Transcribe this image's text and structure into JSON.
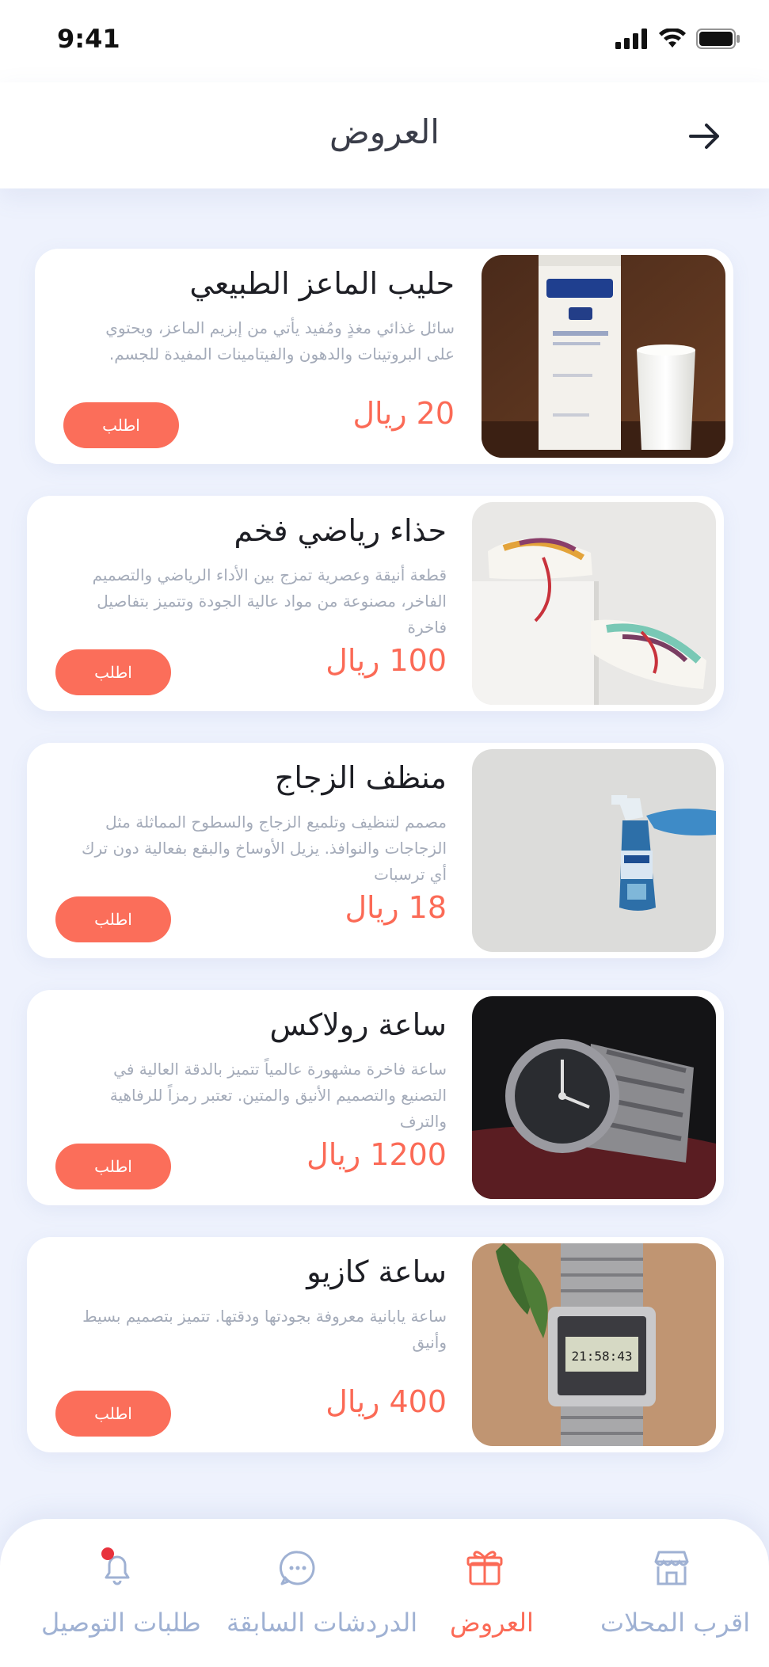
{
  "status_bar": {
    "time": "9:41"
  },
  "header": {
    "title": "العروض"
  },
  "products": [
    {
      "name": "حليب الماعز الطبيعي",
      "description": "سائل غذائي مغذٍ ومُفيد يأتي من إبزيم الماعز، ويحتوي على البروتينات والدهون والفيتامينات المفيدة للجسم.",
      "price": "20 ريال",
      "order_label": "اطلب",
      "image": "goat-milk-carton-and-glass"
    },
    {
      "name": "حذاء رياضي فخم",
      "description": "قطعة أنيقة وعصرية تمزج بين الأداء الرياضي والتصميم الفاخر، مصنوعة من مواد عالية الجودة وتتميز بتفاصيل فاخرة",
      "price": "100 ريال",
      "order_label": "اطلب",
      "image": "sneakers"
    },
    {
      "name": "منظف الزجاج",
      "description": "مصمم لتنظيف وتلميع الزجاج والسطوح المماثلة مثل الزجاجات والنوافذ. يزيل الأوساخ والبقع بفعالية دون ترك أي ترسبات",
      "price": "18 ريال",
      "order_label": "اطلب",
      "image": "glass-cleaner-spray"
    },
    {
      "name": "ساعة رولاكس",
      "description": "ساعة فاخرة مشهورة عالمياً تتميز بالدقة العالية في التصنيع والتصميم الأنيق والمتين. تعتبر رمزاً للرفاهية والترف",
      "price": "1200 ريال",
      "order_label": "اطلب",
      "image": "rolex-watch"
    },
    {
      "name": "ساعة كازيو",
      "description": "ساعة يابانية معروفة بجودتها ودقتها. تتميز بتصميم بسيط وأنيق",
      "price": "400 ريال",
      "order_label": "اطلب",
      "image": "casio-watch",
      "watch_display": "21:58:43"
    }
  ],
  "tab_bar": {
    "active": "offers",
    "tabs": [
      {
        "id": "nearest-shops",
        "label": "اقرب المحلات",
        "icon": "store-icon"
      },
      {
        "id": "offers",
        "label": "العروض",
        "icon": "gift-icon"
      },
      {
        "id": "previous-chats",
        "label": "الدردشات السابقة",
        "icon": "chat-icon"
      },
      {
        "id": "delivery-requests",
        "label": "طلبات التوصيل",
        "icon": "bell-icon",
        "has_badge": true
      }
    ]
  },
  "colors": {
    "accent": "#fb6a56",
    "page_background": "#eef2fd",
    "inactive_tab": "#9fb1d3",
    "badge": "#e8323c"
  }
}
